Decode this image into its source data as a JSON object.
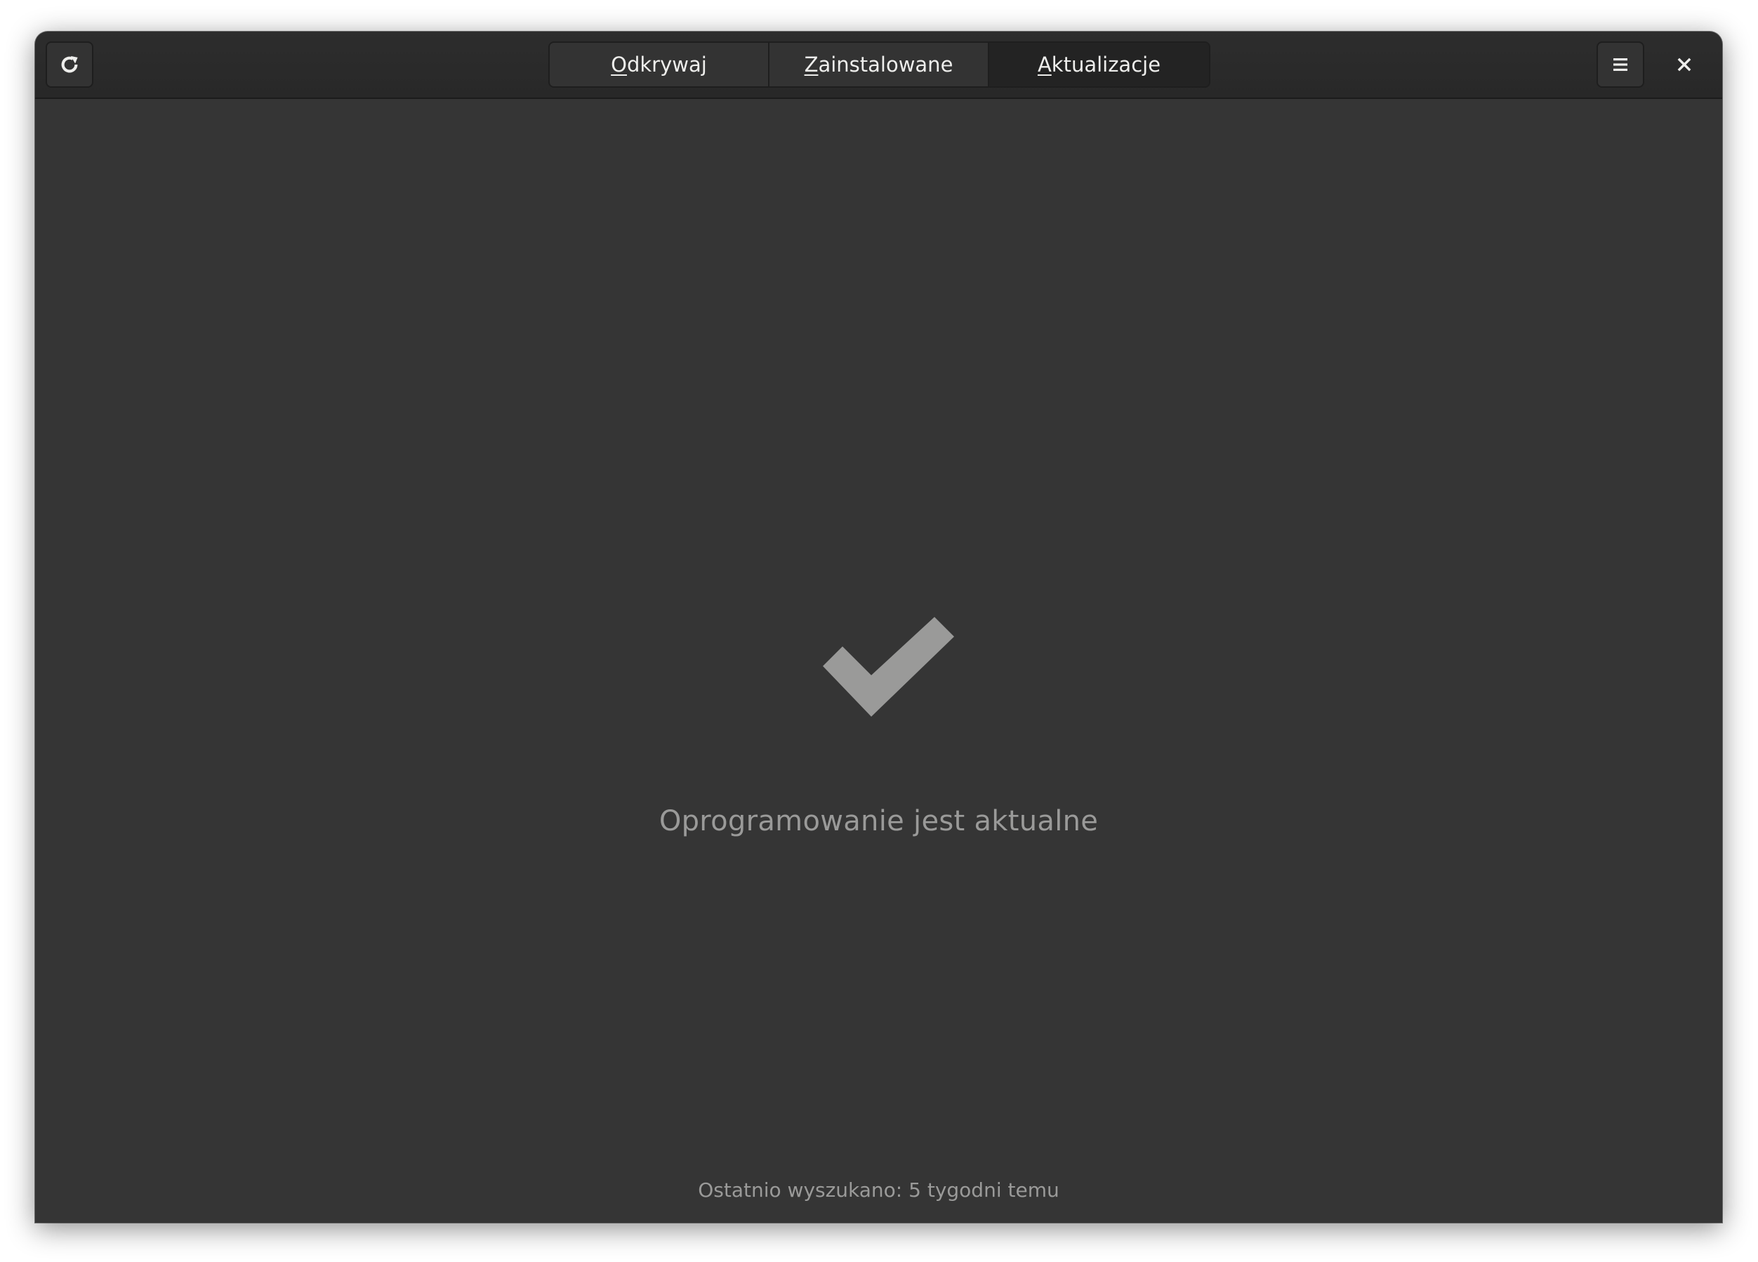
{
  "header": {
    "refresh_icon": "refresh-icon",
    "menu_icon": "hamburger-menu-icon",
    "close_icon": "close-icon",
    "tabs": [
      {
        "mnemonic": "O",
        "rest": "dkrywaj",
        "active": false
      },
      {
        "mnemonic": "Z",
        "rest": "ainstalowane",
        "active": false
      },
      {
        "mnemonic": "A",
        "rest": "ktualizacje",
        "active": true
      }
    ]
  },
  "main": {
    "status_icon": "checkmark-icon",
    "status_title": "Oprogramowanie jest aktualne",
    "last_checked": "Ostatnio wyszukano: 5 tygodni temu"
  },
  "colors": {
    "background": "#353535",
    "headerbar": "#2b2b2b",
    "active_tab": "#232323",
    "check": "#9a9a99",
    "text_dim": "#9a9a99",
    "text": "#eeeeec"
  }
}
